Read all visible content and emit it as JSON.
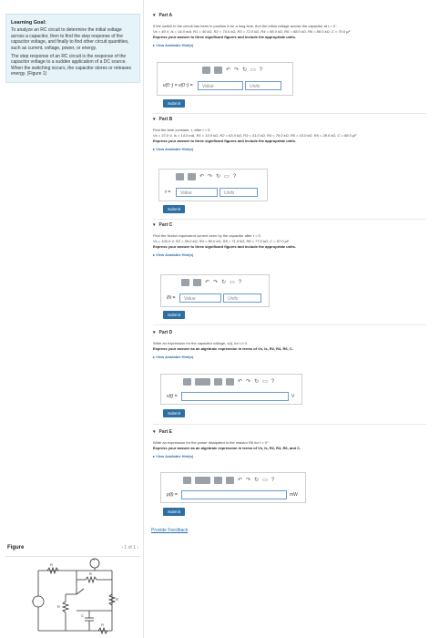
{
  "goal": {
    "title": "Learning Goal:",
    "p1": "To analyze an RC circuit to determine the initial voltage across a capacitor, then to find the step response of the capacitor voltage, and finally to find other circuit quantities, such as current, voltage, power, or energy.",
    "p2": "The step response of an RC circuit is the response of the capacitor voltage to a sudden application of a DC source. When the switching occurs, the capacitor stores or releases energy. (Figure 1)"
  },
  "figure": {
    "label": "Figure",
    "nav": "‹ 1 of 1 ›"
  },
  "parts": [
    {
      "head": "Part A",
      "text": "If the switch in the circuit has been in position A for a long time, find the initial voltage across the capacitor at t = 0⁻.",
      "values": "Vs = 40 V, Is = 14.0 mA, R1 = 40 kΩ, R2 = 74.0 kΩ, R3 = 72.0 kΩ, R4 = 98.0 kΩ, R5 = 68.0 kΩ, R6 = 88.0 kΩ, C = 70.0 μF",
      "instr": "Express your answer to three significant figures and include the appropriate units.",
      "hints": "▸ View Available Hint(s)",
      "label": "v(0⁻) = v(0⁺) =",
      "ph1": "Value",
      "ph2": "Units",
      "submit": "Submit"
    },
    {
      "head": "Part B",
      "text": "Find the time constant, τ, after t = 0.",
      "values": "Vs = 37.0 V, Is = 14.0 mA, R1 = 13.0 kΩ, R2 = 63.0 kΩ, R3 = 31.0 kΩ, R4 = 79.0 kΩ, R5 = 15.0 kΩ, R6 = 28.0 kΩ, C = 68.0 μF",
      "instr": "Express your answer to three significant figures and include the appropriate units.",
      "hints": "▸ View Available Hint(s)",
      "label": "τ =",
      "ph1": "Value",
      "ph2": "Units",
      "submit": "Submit"
    },
    {
      "head": "Part C",
      "text": "Find the Norton equivalent current seen by the capacitor after t = 0.",
      "values": "Vs = 100.0 V, R2 = 59.0 kΩ, R4 = 80.0 kΩ, R5 = 71.0 kΩ, R6 = 77.0 kΩ, C = 87.0 μF",
      "instr": "Express your answer to three significant figures and include the appropriate units.",
      "hints": "▸ View Available Hint(s)",
      "label": "IN =",
      "ph1": "Value",
      "ph2": "Units",
      "submit": "Submit"
    },
    {
      "head": "Part D",
      "text": "Write an expression for the capacitor voltage, v(t), for t ≥ 0.",
      "instr": "Express your answer as an algebraic expression in terms of Vs, Is, R2, R4, R6, C.",
      "hints": "▸ View Available Hint(s)",
      "label": "v(t) =",
      "unit": "V",
      "submit": "Submit"
    },
    {
      "head": "Part E",
      "text": "Write an expression for the power dissipated in the resistor R6 for t > 0⁺.",
      "instr": "Express your answer as an algebraic expression in terms of Vs, Is, R2, R4, R6, and C.",
      "hints": "▸ View Available Hint(s)",
      "label": "p(t) =",
      "unit": "mW",
      "submit": "Submit"
    }
  ],
  "feedback": "Provide Feedback",
  "colors": {
    "accent": "#2d6fa3",
    "goal_bg": "#e6f3f8",
    "link": "#2a6fb0"
  },
  "icons": [
    "templates-icon",
    "mu-icon",
    "undo-icon",
    "redo-icon",
    "reset-icon",
    "keyboard-icon",
    "help-icon"
  ]
}
